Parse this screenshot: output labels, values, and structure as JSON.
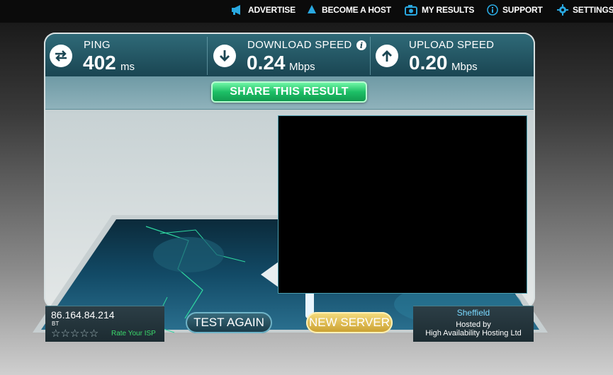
{
  "nav": {
    "advertise": "ADVERTISE",
    "become_host": "BECOME A HOST",
    "my_results": "MY RESULTS",
    "support": "SUPPORT",
    "settings": "SETTINGS"
  },
  "stats": {
    "ping": {
      "label": "PING",
      "value": "402",
      "unit": "ms"
    },
    "download": {
      "label": "DOWNLOAD SPEED",
      "value": "0.24",
      "unit": "Mbps"
    },
    "upload": {
      "label": "UPLOAD SPEED",
      "value": "0.20",
      "unit": "Mbps"
    }
  },
  "share_label": "SHARE THIS RESULT",
  "client": {
    "ip": "86.164.84.214",
    "isp": "BT",
    "rating_stars": "☆☆☆☆☆",
    "rate_label": "Rate Your ISP"
  },
  "buttons": {
    "test_again": "TEST AGAIN",
    "new_server": "NEW SERVER"
  },
  "server": {
    "city": "Sheffield",
    "hosted_line1": "Hosted by",
    "hosted_line2": "High Availability Hosting Ltd"
  },
  "colors": {
    "stat_bar": "#1a4552",
    "share_button": "#1dbf66",
    "new_server_button": "#c89d2c",
    "rate_isp_text": "#3bd96b",
    "city_text": "#7ad9ff"
  }
}
